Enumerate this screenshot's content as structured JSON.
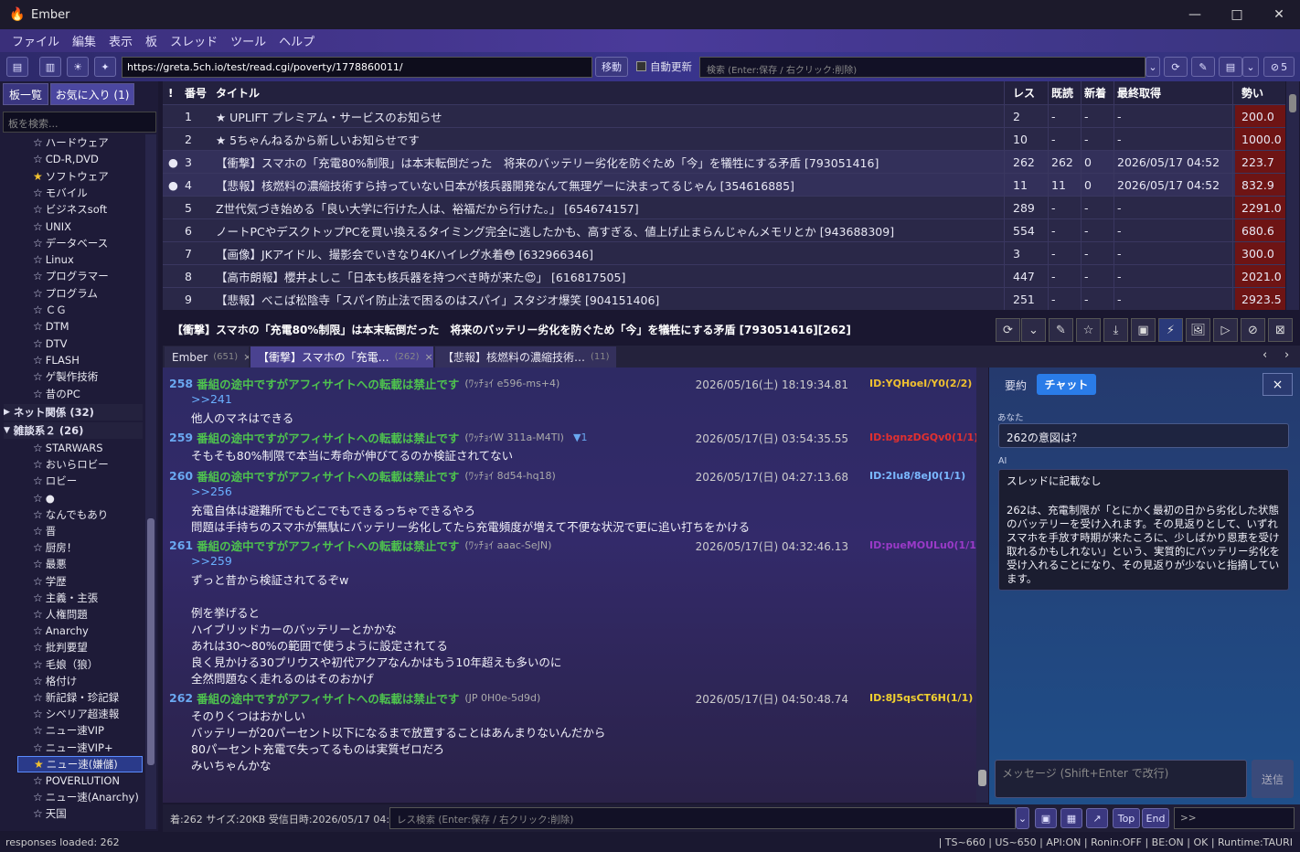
{
  "app": {
    "title": "Ember"
  },
  "window": {
    "minimize": "—",
    "maximize": "□",
    "close": "✕"
  },
  "menu": [
    "ファイル",
    "編集",
    "表示",
    "板",
    "スレッド",
    "ツール",
    "ヘルプ"
  ],
  "toolbar": {
    "url": "https://greta.5ch.io/test/read.cgi/poverty/1778860011/",
    "go": "移動",
    "auto_update": "自動更新",
    "search_placeholder": "検索 (Enter:保存 / 右クリック:削除)",
    "ng_count": "5"
  },
  "sidebar": {
    "tab_boards": "板一覧",
    "tab_favs": "お気に入り (1)",
    "search_placeholder": "板を検索...",
    "items": [
      {
        "label": "ハードウェア",
        "star": false
      },
      {
        "label": "CD-R,DVD",
        "star": false
      },
      {
        "label": "ソフトウェア",
        "star": true
      },
      {
        "label": "モバイル",
        "star": false
      },
      {
        "label": "ビジネスsoft",
        "star": false
      },
      {
        "label": "UNIX",
        "star": false
      },
      {
        "label": "データベース",
        "star": false
      },
      {
        "label": "Linux",
        "star": false
      },
      {
        "label": "プログラマー",
        "star": false
      },
      {
        "label": "プログラム",
        "star": false
      },
      {
        "label": "ＣＧ",
        "star": false
      },
      {
        "label": "DTM",
        "star": false
      },
      {
        "label": "DTV",
        "star": false
      },
      {
        "label": "FLASH",
        "star": false
      },
      {
        "label": "ゲ製作技術",
        "star": false
      },
      {
        "label": "昔のPC",
        "star": false
      }
    ],
    "cat1": "ネット関係 (32)",
    "cat2": "雑談系２ (26)",
    "items2": [
      {
        "label": "STARWARS",
        "star": false
      },
      {
        "label": "おいらロビー",
        "star": false
      },
      {
        "label": "ロビー",
        "star": false
      },
      {
        "label": "●",
        "star": false
      },
      {
        "label": "なんでもあり",
        "star": false
      },
      {
        "label": "晋",
        "star": false
      },
      {
        "label": "厨房！",
        "star": false
      },
      {
        "label": "最悪",
        "star": false
      },
      {
        "label": "学歴",
        "star": false
      },
      {
        "label": "主義・主張",
        "star": false
      },
      {
        "label": "人権問題",
        "star": false
      },
      {
        "label": "Anarchy",
        "star": false
      },
      {
        "label": "批判要望",
        "star": false
      },
      {
        "label": "毛娘（狼）",
        "star": false
      },
      {
        "label": "格付け",
        "star": false
      },
      {
        "label": "新記録・珍記録",
        "star": false
      },
      {
        "label": "シベリア超速報",
        "star": false
      },
      {
        "label": "ニュー速VIP",
        "star": false
      },
      {
        "label": "ニュー速VIP+",
        "star": false
      },
      {
        "label": "ニュー速(嫌儲)",
        "star": true,
        "selected": true
      },
      {
        "label": "POVERLUTION",
        "star": false
      },
      {
        "label": "ニュー速(Anarchy)",
        "star": false
      },
      {
        "label": "天国",
        "star": false
      }
    ]
  },
  "thread_list": {
    "headers": {
      "mark": "!",
      "num": "番号",
      "title": "タイトル",
      "res": "レス",
      "read": "既読",
      "new": "新着",
      "last": "最終取得",
      "ikioi": "勢い"
    },
    "rows": [
      {
        "mark": "",
        "num": "1",
        "title": "★ UPLIFT プレミアム・サービスのお知らせ",
        "res": "2",
        "read": "-",
        "new": "-",
        "last": "-",
        "ikioi": "200.0"
      },
      {
        "mark": "",
        "num": "2",
        "title": "★ 5ちゃんねるから新しいお知らせです",
        "res": "10",
        "read": "-",
        "new": "-",
        "last": "-",
        "ikioi": "1000.0"
      },
      {
        "mark": "●",
        "num": "3",
        "title": "【衝撃】スマホの「充電80%制限」は本末転倒だった　将来のバッテリー劣化を防ぐため「今」を犠牲にする矛盾 [793051416]",
        "res": "262",
        "read": "262",
        "new": "0",
        "last": "2026/05/17 04:52",
        "ikioi": "223.7"
      },
      {
        "mark": "●",
        "num": "4",
        "title": "【悲報】核燃料の濃縮技術すら持っていない日本が核兵器開発なんて無理ゲーに決まってるじゃん [354616885]",
        "res": "11",
        "read": "11",
        "new": "0",
        "last": "2026/05/17 04:52",
        "ikioi": "832.9"
      },
      {
        "mark": "",
        "num": "5",
        "title": "Z世代気づき始める「良い大学に行けた人は、裕福だから行けた。」 [654674157]",
        "res": "289",
        "read": "-",
        "new": "-",
        "last": "-",
        "ikioi": "2291.0"
      },
      {
        "mark": "",
        "num": "6",
        "title": "ノートPCやデスクトップPCを買い換えるタイミング完全に逃したかも、高すぎる、値上げ止まらんじゃんメモリとか [943688309]",
        "res": "554",
        "read": "-",
        "new": "-",
        "last": "-",
        "ikioi": "680.6"
      },
      {
        "mark": "",
        "num": "7",
        "title": "【画像】JKアイドル、撮影会でいきなり4Kハイレグ水着😳 [632966346]",
        "res": "3",
        "read": "-",
        "new": "-",
        "last": "-",
        "ikioi": "300.0"
      },
      {
        "mark": "",
        "num": "8",
        "title": "【高市朗報】櫻井よしこ「日本も核兵器を持つべき時が来た😍」 [616817505]",
        "res": "447",
        "read": "-",
        "new": "-",
        "last": "-",
        "ikioi": "2021.0"
      },
      {
        "mark": "",
        "num": "9",
        "title": "【悲報】べこぱ松陰寺「スパイ防止法で困るのはスパイ」スタジオ爆笑 [904151406]",
        "res": "251",
        "read": "-",
        "new": "-",
        "last": "-",
        "ikioi": "2923.5"
      }
    ]
  },
  "thread": {
    "title": "【衝撃】スマホの「充電80%制限」は本末転倒だった　将来のバッテリー劣化を防ぐため「今」を犠牲にする矛盾 [793051416][262]"
  },
  "tabs": [
    {
      "label": "Ember",
      "count": "(651)"
    },
    {
      "label": "【衝撃】スマホの「充電…",
      "count": "(262)"
    },
    {
      "label": "【悲報】核燃料の濃縮技術…",
      "count": "(11)"
    }
  ],
  "posts": [
    {
      "num": "258",
      "name": "番組の途中ですがアフィサイトへの転載は禁止です",
      "trip": "(ﾜｯﾁｮｲ e596-ms+4)",
      "date": "2026/05/16(土) 18:19:34.81",
      "id": "ID:YQHoeI/Y0(2/2)",
      "idcolor": "#f0c030",
      "reply": "",
      "lines": [
        ">>241",
        "他人のマネはできる"
      ]
    },
    {
      "num": "259",
      "name": "番組の途中ですがアフィサイトへの転載は禁止です",
      "trip": "(ﾜｯﾁｮｲW 311a-M4TI)",
      "date": "2026/05/17(日) 03:54:35.55",
      "id": "ID:bgnzDGQv0(1/1)",
      "idcolor": "#e03030",
      "reply": "▼1",
      "lines": [
        "そもそも80%制限で本当に寿命が伸びてるのか検証されてない"
      ]
    },
    {
      "num": "260",
      "name": "番組の途中ですがアフィサイトへの転載は禁止です",
      "trip": "(ﾜｯﾁｮｲ 8d54-hq18)",
      "date": "2026/05/17(日) 04:27:13.68",
      "id": "ID:2Iu8/8eJ0(1/1)",
      "idcolor": "#7ab8ff",
      "reply": "",
      "lines": [
        ">>256",
        "充電自体は避難所でもどこでもできるっちゃできるやろ",
        "問題は手持ちのスマホが無駄にバッテリー劣化してたら充電頻度が増えて不便な状況で更に追い打ちをかける"
      ]
    },
    {
      "num": "261",
      "name": "番組の途中ですがアフィサイトへの転載は禁止です",
      "trip": "(ﾜｯﾁｮｲ aaac-SeJN)",
      "date": "2026/05/17(日) 04:32:46.13",
      "id": "ID:pueMOULu0(1/1)",
      "idcolor": "#9a3ac8",
      "reply": "",
      "lines": [
        ">>259",
        "ずっと昔から検証されてるぞw",
        "",
        "例を挙げると",
        "ハイブリッドカーのバッテリーとかかな",
        "あれは30〜80%の範囲で使うように設定されてる",
        "良く見かける30プリウスや初代アクアなんかはもう10年超えも多いのに",
        "全然問題なく走れるのはそのおかげ"
      ]
    },
    {
      "num": "262",
      "name": "番組の途中ですがアフィサイトへの転載は禁止です",
      "trip": "(JP 0H0e-5d9d)",
      "date": "2026/05/17(日) 04:50:48.74",
      "id": "ID:8J5qsCT6H(1/1)",
      "idcolor": "#f0d030",
      "reply": "",
      "lines": [
        "そのりくつはおかしい",
        "バッテリーが20パーセント以下になるまで放置することはあんまりないんだから",
        "80パーセント充電で失ってるものは実質ゼロだろ",
        "みいちゃんかな"
      ]
    }
  ],
  "ai": {
    "tab_summary": "要約",
    "tab_chat": "チャット",
    "you_label": "あなた",
    "you_msg": "262の意図は？",
    "ai_label": "AI",
    "ai_msg1": "スレッドに記載なし",
    "ai_msg2": "262は、充電制限が「とにかく最初の日から劣化した状態のバッテリーを受け入れます。その見返りとして、いずれスマホを手放す時期が来たころに、少しばかり恩恵を受け取れるかもしれない」という、実質的にバッテリー劣化を受け入れることになり、その見返りが少ないと指摘しています。",
    "input_placeholder": "メッセージ (Shift+Enter で改行)",
    "send": "送信"
  },
  "footer": {
    "info": "着:262 サイズ:20KB 受信日時:2026/05/17 04:52",
    "res_search_placeholder": "レス検索 (Enter:保存 / 右クリック:削除)",
    "top": "Top",
    "end": "End",
    "jump": ">>"
  },
  "status": {
    "left": "responses loaded: 262",
    "right": "| TS~660 | US~650 | API:ON | Ronin:OFF | BE:ON | OK | Runtime:TAURI"
  }
}
